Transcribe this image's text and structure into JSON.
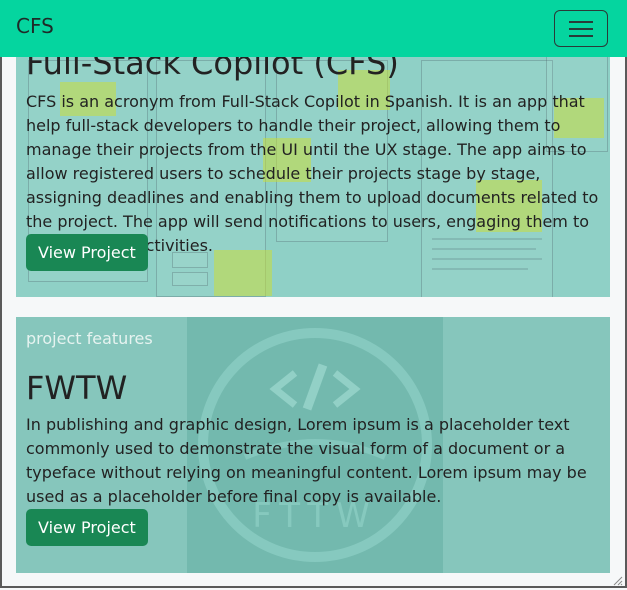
{
  "navbar": {
    "brand": "CFS",
    "toggler_icon": "hamburger-icon"
  },
  "projects": [
    {
      "title": "Full-Stack Copilot (CFS)",
      "description": "CFS is an acronym from Full-Stack Copilot in Spanish. It is an app that help full-stack developers to handle their project, allowing them to manage their projects from the UI until the UX stage. The app aims to allow registered users to schedule their projects stage by stage, assigning deadlines and enabling them to upload documents related to the project. The app will send notifications to users, engaging them to achieve their activities.",
      "button": "View Project"
    },
    {
      "label": "project features",
      "title": "FWTW",
      "description": "In publishing and graphic design, Lorem ipsum is a placeholder text commonly used to demonstrate the visual form of a document or a typeface without relying on meaningful content. Lorem ipsum may be used as a placeholder before final copy is available.",
      "button": "View Project"
    }
  ],
  "colors": {
    "navbar": "#05d59f",
    "button": "#198754",
    "card_overlay": "#8fd0c6"
  }
}
